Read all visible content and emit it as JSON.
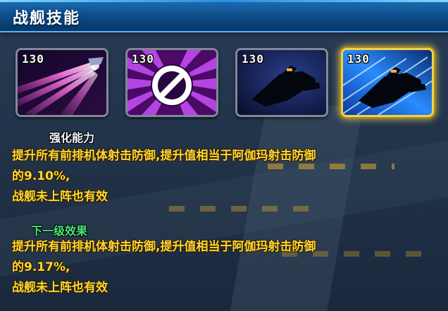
{
  "panel": {
    "title": "战舰技能"
  },
  "skills": [
    {
      "level": "130",
      "icon": "pink-laser-beams-icon",
      "selected": false
    },
    {
      "level": "130",
      "icon": "purple-prohibit-icon",
      "selected": false
    },
    {
      "level": "130",
      "icon": "ship-silhouette-icon",
      "selected": false
    },
    {
      "level": "130",
      "icon": "ship-speed-blue-icon",
      "selected": true
    }
  ],
  "current": {
    "heading": "强化能力",
    "lines": [
      "提升所有前排机体射击防御,提升值相当于阿伽玛射击防御",
      "的9.10%,",
      "战舰未上阵也有效"
    ]
  },
  "next": {
    "heading": "下一级效果",
    "lines": [
      "提升所有前排机体射击防御,提升值相当于阿伽玛射击防御",
      "的9.17%,",
      "战舰未上阵也有效"
    ]
  },
  "colors": {
    "title_bar": "#0d4a86",
    "selected_border": "#f0d24a",
    "description_text": "#ffd533",
    "next_heading": "#49e87a"
  }
}
